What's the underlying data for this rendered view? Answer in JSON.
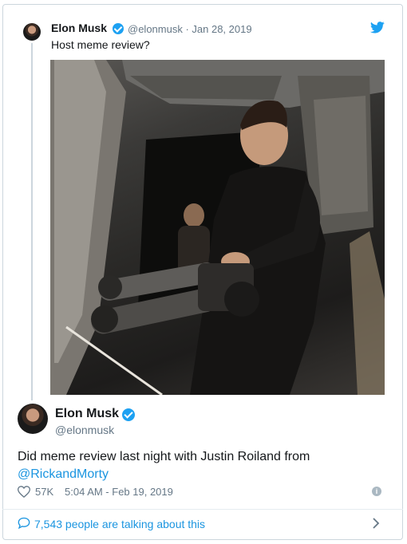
{
  "quoted_tweet": {
    "name": "Elon Musk",
    "handle_date": "@elonmusk · Jan 28, 2019",
    "text": "Host meme review?"
  },
  "photo": {
    "alt_description": ""
  },
  "main_tweet": {
    "name": "Elon Musk",
    "handle": "@elonmusk",
    "text_prefix": "Did meme review last night with Justin Roiland from",
    "mention": "@RickandMorty",
    "likes": "57K",
    "timestamp": "5:04 AM - Feb 19, 2019"
  },
  "footer": {
    "talking_text": "7,543 people are talking about this"
  },
  "colors": {
    "accent": "#1da1f2",
    "link": "#1b95e0",
    "muted": "#657786",
    "border": "#ccd6dd"
  },
  "icons": [
    "twitter-bird-icon",
    "verified-badge-icon",
    "heart-icon",
    "info-icon",
    "comment-bubble-icon",
    "chevron-right-icon"
  ]
}
